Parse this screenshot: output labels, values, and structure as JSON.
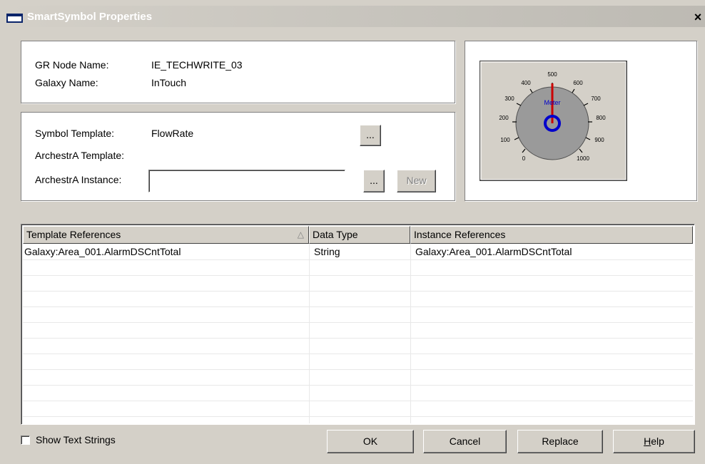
{
  "window": {
    "title": "SmartSymbol Properties",
    "close_glyph": "×"
  },
  "info": {
    "gr_node_label": "GR Node Name:",
    "gr_node_value": "IE_TECHWRITE_03",
    "galaxy_label": "Galaxy Name:",
    "galaxy_value": "InTouch"
  },
  "template": {
    "symbol_template_label": "Symbol Template:",
    "symbol_template_value": "FlowRate",
    "archestra_template_label": "ArchestrA Template:",
    "archestra_instance_label": "ArchestrA Instance:",
    "archestra_instance_value": "",
    "browse_label": "...",
    "new_label": "New"
  },
  "preview": {
    "meter_label": "Meter",
    "dial_ticks": [
      "0",
      "100",
      "200",
      "300",
      "400",
      "500",
      "600",
      "700",
      "800",
      "900",
      "1000"
    ],
    "colors": {
      "face": "#9a9a9a",
      "needle": "#cc0000",
      "hub": "#0000cc"
    }
  },
  "references": {
    "columns": [
      "Template References",
      "Data Type",
      "Instance References"
    ],
    "rows": [
      {
        "template_ref": "Galaxy:Area_001.AlarmDSCntTotal",
        "data_type": "String",
        "instance_ref": "Galaxy:Area_001.AlarmDSCntTotal"
      }
    ]
  },
  "footer": {
    "show_text_strings_label": "Show Text Strings",
    "show_text_strings_checked": false,
    "ok_label": "OK",
    "cancel_label": "Cancel",
    "replace_label": "Replace",
    "help_label": "Help",
    "help_mnemonic": "H"
  }
}
